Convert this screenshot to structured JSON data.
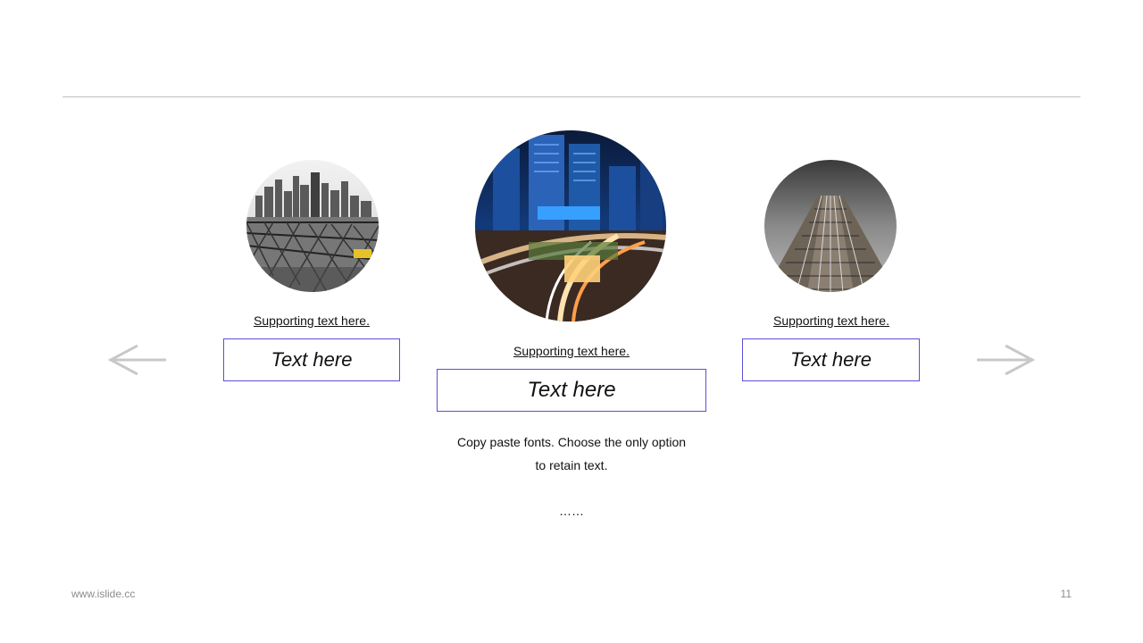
{
  "slide": {
    "left": {
      "supporting": "Supporting  text here.",
      "title": "Text here",
      "image": "bridge-city-bw-photo"
    },
    "center": {
      "supporting": "Supporting  text here.",
      "title": "Text here",
      "image": "city-night-traffic-photo",
      "description_line1": "Copy paste fonts. Choose the only option",
      "description_line2": "to retain text.",
      "ellipsis": "……"
    },
    "right": {
      "supporting": "Supporting  text here.",
      "title": "Text here",
      "image": "skyscraper-upward-photo"
    },
    "nav": {
      "prev_icon": "arrow-left-icon",
      "next_icon": "arrow-right-icon"
    }
  },
  "footer": {
    "website": "www.islide.cc",
    "page_number": "11"
  },
  "colors": {
    "accent_border": "#5b4fd6",
    "arrow": "#c8c8c8",
    "rule": "#bfbfbf"
  }
}
